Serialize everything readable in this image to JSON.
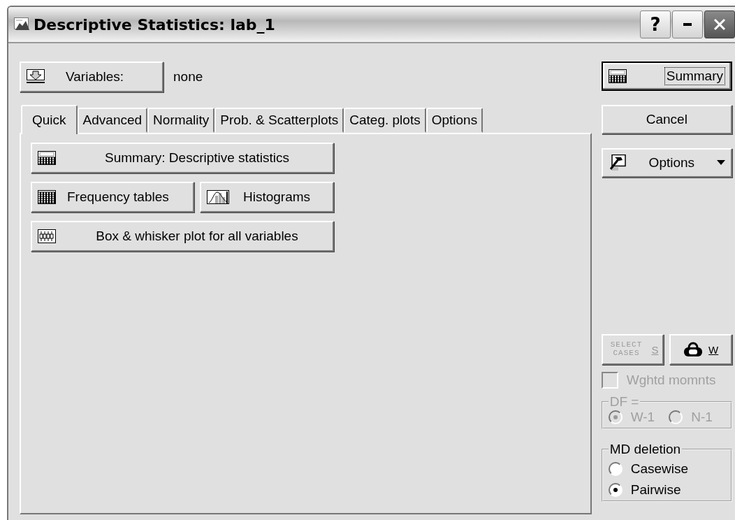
{
  "window": {
    "title": "Descriptive Statistics: lab_1",
    "help_button": "?"
  },
  "variables": {
    "button": "Variables:",
    "value": "none"
  },
  "tabs": [
    {
      "label": "Quick",
      "selected": true
    },
    {
      "label": "Advanced",
      "selected": false
    },
    {
      "label": "Normality",
      "selected": false
    },
    {
      "label": "Prob. & Scatterplots",
      "selected": false
    },
    {
      "label": "Categ. plots",
      "selected": false
    },
    {
      "label": "Options",
      "selected": false
    }
  ],
  "quick_rows": [
    [
      {
        "kind": "summary",
        "label": "Summary: Descriptive statistics"
      }
    ],
    [
      {
        "kind": "frequency",
        "label": "Frequency tables"
      },
      {
        "kind": "histogram",
        "label": "Histograms"
      }
    ],
    [
      {
        "kind": "boxplot",
        "label": "Box & whisker plot for all variables"
      }
    ]
  ],
  "side": {
    "summary_button": {
      "label": "Summary",
      "default": true
    },
    "cancel_button": "Cancel",
    "options_button": "Options",
    "select_cases": {
      "caption": "SELECT CASES",
      "key": "S",
      "disabled": true
    },
    "weight_button": {
      "key": "W"
    },
    "weighted_moments": {
      "label": "Wghtd momnts",
      "checked": false,
      "disabled": true
    },
    "df_group": {
      "label": "DF =",
      "disabled": true,
      "options": [
        {
          "label": "W-1",
          "selected": true
        },
        {
          "label": "N-1",
          "selected": false
        }
      ]
    },
    "md_deletion": {
      "label": "MD deletion",
      "options": [
        {
          "label": "Casewise",
          "selected": false
        },
        {
          "label": "Pairwise",
          "selected": true
        }
      ]
    }
  }
}
